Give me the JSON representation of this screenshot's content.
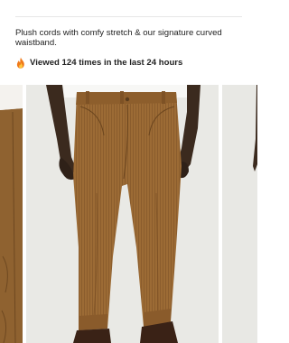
{
  "product": {
    "description": "Plush cords with comfy stretch & our signature curved waistband.",
    "views_text": "Viewed 124 times in the last 24 hours"
  },
  "icons": {
    "views": "fire-icon"
  },
  "gallery": {
    "images": [
      "corduroy-pants-detail",
      "corduroy-pants-front",
      "corduroy-pants-side"
    ]
  },
  "colors": {
    "pants": "#9c6b35",
    "background": "#e8e8e4",
    "fire": "#f07a1a"
  }
}
